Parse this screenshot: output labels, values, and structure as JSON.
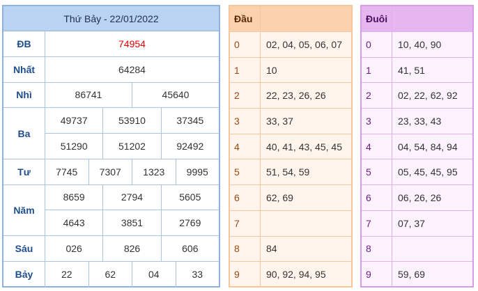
{
  "results": {
    "title": "Thứ Bảy - 22/01/2022",
    "prizes": [
      {
        "label": "ĐB",
        "lines": [
          [
            "74954"
          ]
        ],
        "highlight": true
      },
      {
        "label": "Nhất",
        "lines": [
          [
            "64284"
          ]
        ]
      },
      {
        "label": "Nhì",
        "lines": [
          [
            "86741",
            "45640"
          ]
        ]
      },
      {
        "label": "Ba",
        "lines": [
          [
            "49737",
            "53910",
            "37345"
          ],
          [
            "51290",
            "51202",
            "92492"
          ]
        ]
      },
      {
        "label": "Tư",
        "lines": [
          [
            "7745",
            "7307",
            "1323",
            "9995"
          ]
        ]
      },
      {
        "label": "Năm",
        "lines": [
          [
            "8659",
            "2794",
            "5605"
          ],
          [
            "4643",
            "3851",
            "2769"
          ]
        ]
      },
      {
        "label": "Sáu",
        "lines": [
          [
            "026",
            "826",
            "606"
          ]
        ]
      },
      {
        "label": "Bảy",
        "lines": [
          [
            "22",
            "62",
            "04",
            "33"
          ]
        ]
      }
    ]
  },
  "dau": {
    "header": "Đầu",
    "rows": [
      {
        "key": "0",
        "value": "02, 04, 05, 06, 07"
      },
      {
        "key": "1",
        "value": "10"
      },
      {
        "key": "2",
        "value": "22, 23, 26, 26"
      },
      {
        "key": "3",
        "value": "33, 37"
      },
      {
        "key": "4",
        "value": "40, 41, 43, 45, 45"
      },
      {
        "key": "5",
        "value": "51, 54, 59"
      },
      {
        "key": "6",
        "value": "62, 69"
      },
      {
        "key": "7",
        "value": ""
      },
      {
        "key": "8",
        "value": "84"
      },
      {
        "key": "9",
        "value": "90, 92, 94, 95"
      }
    ]
  },
  "duoi": {
    "header": "Đuôi",
    "rows": [
      {
        "key": "0",
        "value": "10, 40, 90"
      },
      {
        "key": "1",
        "value": "41, 51"
      },
      {
        "key": "2",
        "value": "02, 22, 62, 92"
      },
      {
        "key": "3",
        "value": "23, 33, 43"
      },
      {
        "key": "4",
        "value": "04, 54, 84, 94"
      },
      {
        "key": "5",
        "value": "05, 45, 45, 95"
      },
      {
        "key": "6",
        "value": "06, 26, 26"
      },
      {
        "key": "7",
        "value": "07, 37"
      },
      {
        "key": "8",
        "value": ""
      },
      {
        "key": "9",
        "value": "59, 69"
      }
    ]
  },
  "colors": {
    "special_prize": "#e00000",
    "results_header": "#b9d3f1",
    "dau_header": "#fbd2ad",
    "duoi_header": "#e6b6f0"
  }
}
